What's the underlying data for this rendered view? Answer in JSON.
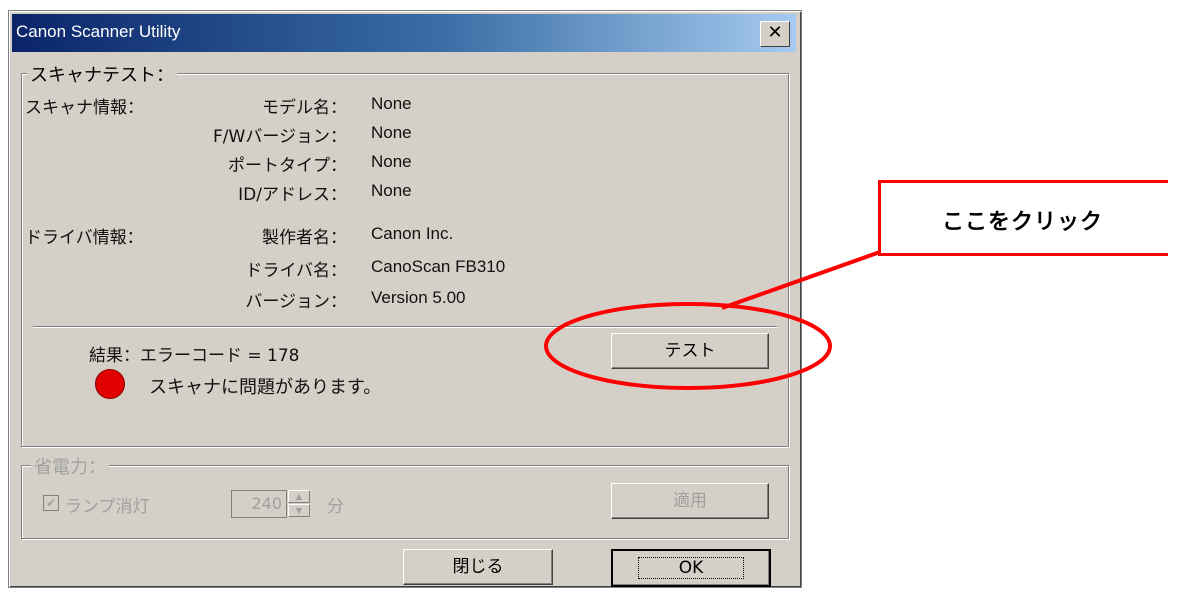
{
  "window": {
    "title": "Canon Scanner Utility",
    "close_glyph": "✕"
  },
  "scanner_test": {
    "legend": "スキャナテスト：",
    "scanner_info_label": "スキャナ情報：",
    "driver_info_label": "ドライバ情報：",
    "scanner_fields": [
      {
        "label": "モデル名：",
        "value": "None"
      },
      {
        "label": "F/Wバージョン：",
        "value": "None"
      },
      {
        "label": "ポートタイプ：",
        "value": "None"
      },
      {
        "label": "ID/アドレス：",
        "value": "None"
      }
    ],
    "driver_fields": [
      {
        "label": "製作者名：",
        "value": "Canon Inc."
      },
      {
        "label": "ドライバ名：",
        "value": "CanoScan FB310"
      },
      {
        "label": "バージョン：",
        "value": "Version 5.00"
      }
    ],
    "result_text": "結果：エラーコード = 178",
    "status_message": "スキャナに問題があります。",
    "status_color": "#e00000",
    "test_button_label": "テスト"
  },
  "power_saving": {
    "legend": "省電力：",
    "lamp_off_label": "ランプ消灯",
    "lamp_off_checked": true,
    "minutes_value": "240",
    "minutes_unit": "分",
    "apply_button_label": "適用"
  },
  "footer": {
    "close_button_label": "閉じる",
    "ok_button_label": "OK"
  },
  "annotation": {
    "callout_text": "ここをクリック",
    "highlight_color": "#ff0000"
  }
}
